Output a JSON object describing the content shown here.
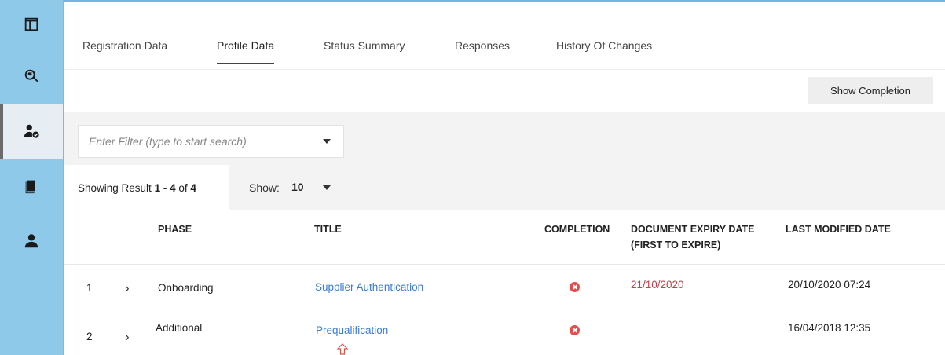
{
  "sidebar": {
    "items": [
      {
        "icon": "dashboard-icon",
        "active": false
      },
      {
        "icon": "globe-search-icon",
        "active": false
      },
      {
        "icon": "user-check-icon",
        "active": true
      },
      {
        "icon": "documents-icon",
        "active": false
      },
      {
        "icon": "user-icon",
        "active": false
      }
    ]
  },
  "tabs": [
    {
      "label": "Registration Data",
      "active": false
    },
    {
      "label": "Profile Data",
      "active": true
    },
    {
      "label": "Status Summary",
      "active": false
    },
    {
      "label": "Responses",
      "active": false
    },
    {
      "label": "History Of Changes",
      "active": false
    }
  ],
  "toolbar": {
    "show_completion_label": "Show Completion"
  },
  "filter": {
    "placeholder": "Enter Filter (type to start search)"
  },
  "results": {
    "prefix": "Showing Result ",
    "range": "1 - 4",
    "of_text": " of ",
    "total": "4",
    "show_label": "Show:",
    "show_value": "10"
  },
  "table": {
    "headers": {
      "phase": "PHASE",
      "title": "TITLE",
      "completion": "COMPLETION",
      "expiry_line1": "DOCUMENT EXPIRY DATE",
      "expiry_line2": "(FIRST TO EXPIRE)",
      "modified": "LAST MODIFIED DATE"
    },
    "rows": [
      {
        "num": "1",
        "expand": "›",
        "phase": "Onboarding",
        "title": "Supplier Authentication",
        "completion": "incomplete",
        "expiry": "21/10/2020",
        "modified": "20/10/2020 07:24"
      },
      {
        "num": "2",
        "expand": "›",
        "phase": "Additional",
        "title": "Prequalification",
        "completion": "incomplete",
        "expiry": "",
        "modified": "16/04/2018 12:35"
      }
    ]
  },
  "colors": {
    "sidebar": "#8ec9ea",
    "link": "#3a7bd5",
    "expiry": "#c0414a",
    "status_incomplete": "#e74c4c",
    "pointer_arrow": "#d9534f"
  }
}
